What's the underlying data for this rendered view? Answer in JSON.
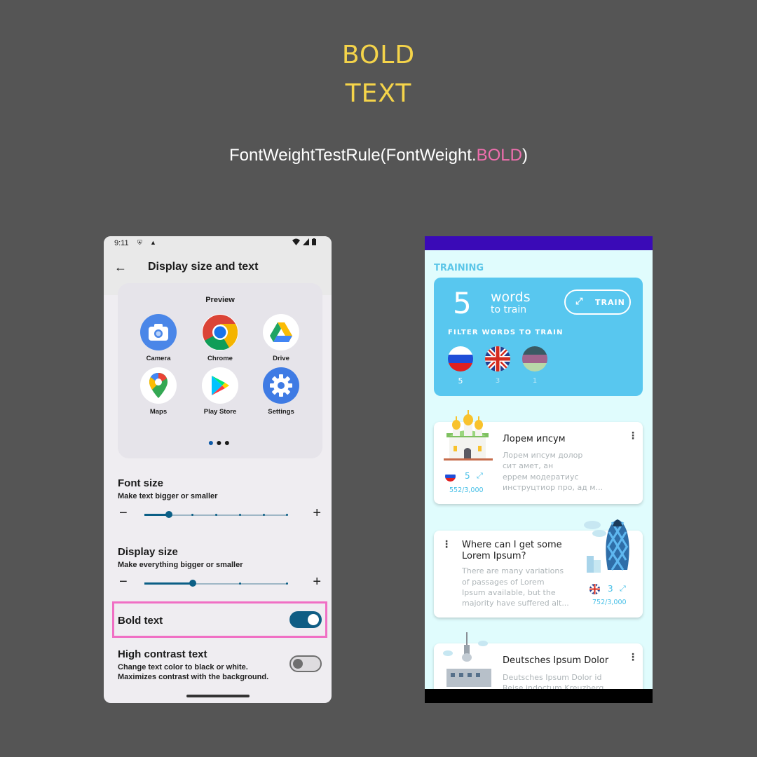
{
  "header": {
    "line1": "BOLD",
    "line2": "TEXT",
    "code_prefix": "FontWeightTestRule(FontWeight.",
    "code_highlight": "BOLD",
    "code_suffix": ")"
  },
  "colors": {
    "background": "#555555",
    "headline": "#f5d44a",
    "highlight": "#ef6fae",
    "toggle_on": "#0f5d84",
    "train_card": "#58c7ef",
    "status_bar_right": "#3a0ab7"
  },
  "settings_screen": {
    "status_time": "9:11",
    "title": "Display size and text",
    "preview": {
      "title": "Preview",
      "apps": [
        {
          "label": "Camera",
          "icon": "camera-icon"
        },
        {
          "label": "Chrome",
          "icon": "chrome-icon"
        },
        {
          "label": "Drive",
          "icon": "drive-icon"
        },
        {
          "label": "Maps",
          "icon": "maps-icon"
        },
        {
          "label": "Play Store",
          "icon": "play-store-icon"
        },
        {
          "label": "Settings",
          "icon": "settings-icon"
        }
      ]
    },
    "font_size": {
      "title": "Font size",
      "subtitle": "Make text bigger or smaller",
      "step": 2,
      "steps": 7
    },
    "display_size": {
      "title": "Display size",
      "subtitle": "Make everything bigger or smaller",
      "step": 2,
      "steps": 5
    },
    "bold_text": {
      "label": "Bold text",
      "enabled": true
    },
    "high_contrast": {
      "title": "High contrast text",
      "subtitle_line1": "Change text color to black or white.",
      "subtitle_line2": "Maximizes contrast with the background.",
      "enabled": false
    }
  },
  "training_screen": {
    "section_title": "TRAINING",
    "words_count": "5",
    "words_label": "words",
    "to_train_label": "to train",
    "train_button": "TRAIN",
    "filter_title": "FILTER WORDS TO TRAIN",
    "filters": [
      {
        "flag": "russia-flag",
        "count": "5"
      },
      {
        "flag": "uk-flag",
        "count": "3"
      },
      {
        "flag": "other-flag",
        "count": "1"
      }
    ],
    "cards": [
      {
        "title": "Лорем ипсум",
        "desc": [
          "Лорем ипсум долор",
          "сит амет, ан",
          "еррем модератиус",
          "инструцтиор про, ад м..."
        ],
        "flag": "russia-flag",
        "count": "5",
        "progress": "552/3,000",
        "image": "church-icon"
      },
      {
        "title_line1": "Where can I get some",
        "title_line2": "Lorem Ipsum?",
        "desc": [
          "There are many variations",
          "of passages of Lorem",
          "Ipsum available, but the",
          "majority have suffered alt..."
        ],
        "flag": "uk-flag",
        "count": "3",
        "progress": "752/3,000",
        "image": "gherkin-building-icon"
      },
      {
        "title": "Deutsches Ipsum Dolor",
        "desc": [
          "Deutsches Ipsum Dolor id",
          "Reise indoctum Kreuzberg"
        ],
        "image": "tv-tower-icon"
      }
    ]
  }
}
